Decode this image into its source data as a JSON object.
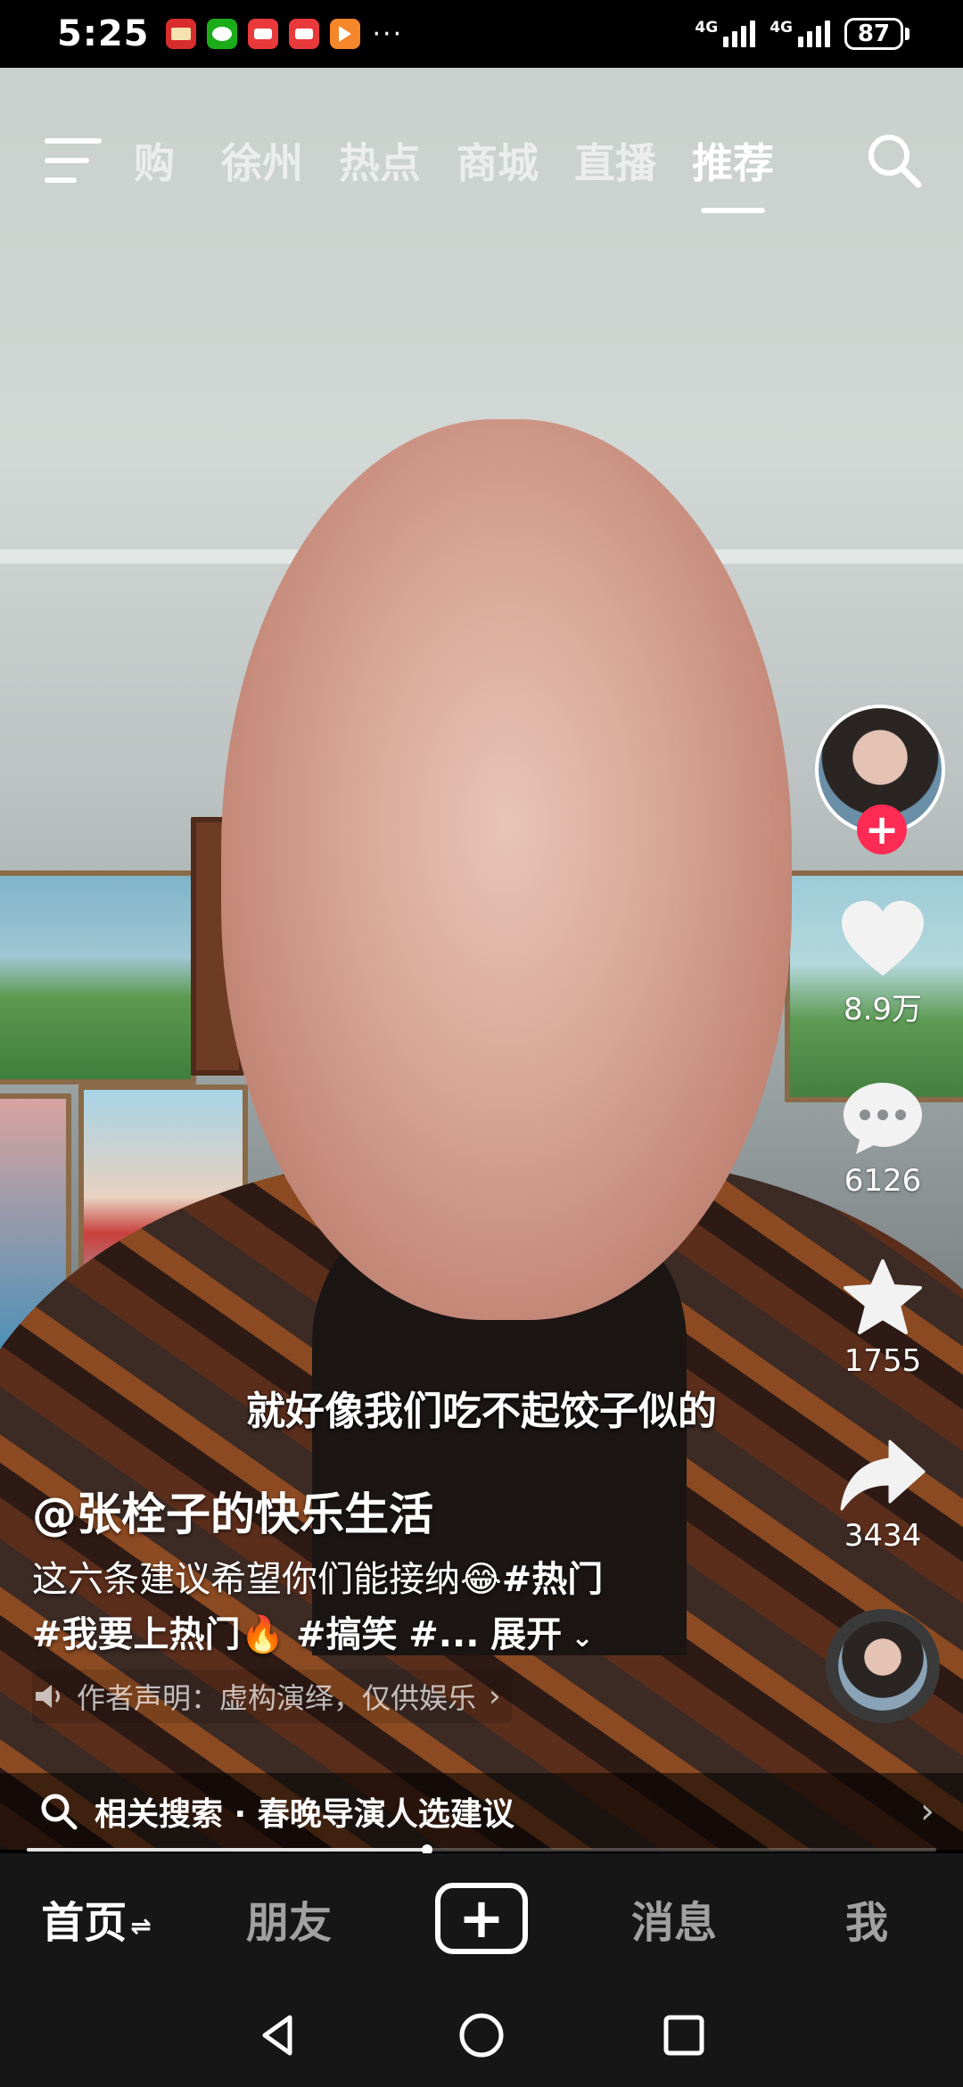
{
  "status_bar": {
    "time": "5:25",
    "more": "···",
    "network1": "4G",
    "network2": "4G",
    "battery": "87"
  },
  "top_nav": {
    "tabs": [
      {
        "label": "购",
        "active": false
      },
      {
        "label": "徐州",
        "active": false
      },
      {
        "label": "热点",
        "active": false
      },
      {
        "label": "商城",
        "active": false
      },
      {
        "label": "直播",
        "active": false
      },
      {
        "label": "推荐",
        "active": true
      }
    ]
  },
  "video": {
    "subtitle": "就好像我们吃不起饺子似的",
    "author": "@张栓子的快乐生活",
    "caption_text": "这六条建议希望你们能接纳",
    "caption_emoji": "😂",
    "tags": [
      "#热门",
      "#我要上热门",
      "#搞笑",
      "#..."
    ],
    "fire_emoji": "🔥",
    "expand_label": "展开",
    "disclaimer": "作者声明：虚构演绎，仅供娱乐",
    "follow_label": "+"
  },
  "actions": {
    "likes": "8.9万",
    "comments": "6126",
    "favorites": "1755",
    "shares": "3434"
  },
  "related_search": {
    "label": "相关搜索 · 春晚导演人选建议"
  },
  "progress": {
    "fraction": 0.44
  },
  "bottom_nav": {
    "home": "首页",
    "home_swap": "⇌",
    "friends": "朋友",
    "create": "+",
    "messages": "消息",
    "me": "我"
  },
  "colors": {
    "accent_red": "#fe2c55",
    "nav_bg": "#161616"
  }
}
